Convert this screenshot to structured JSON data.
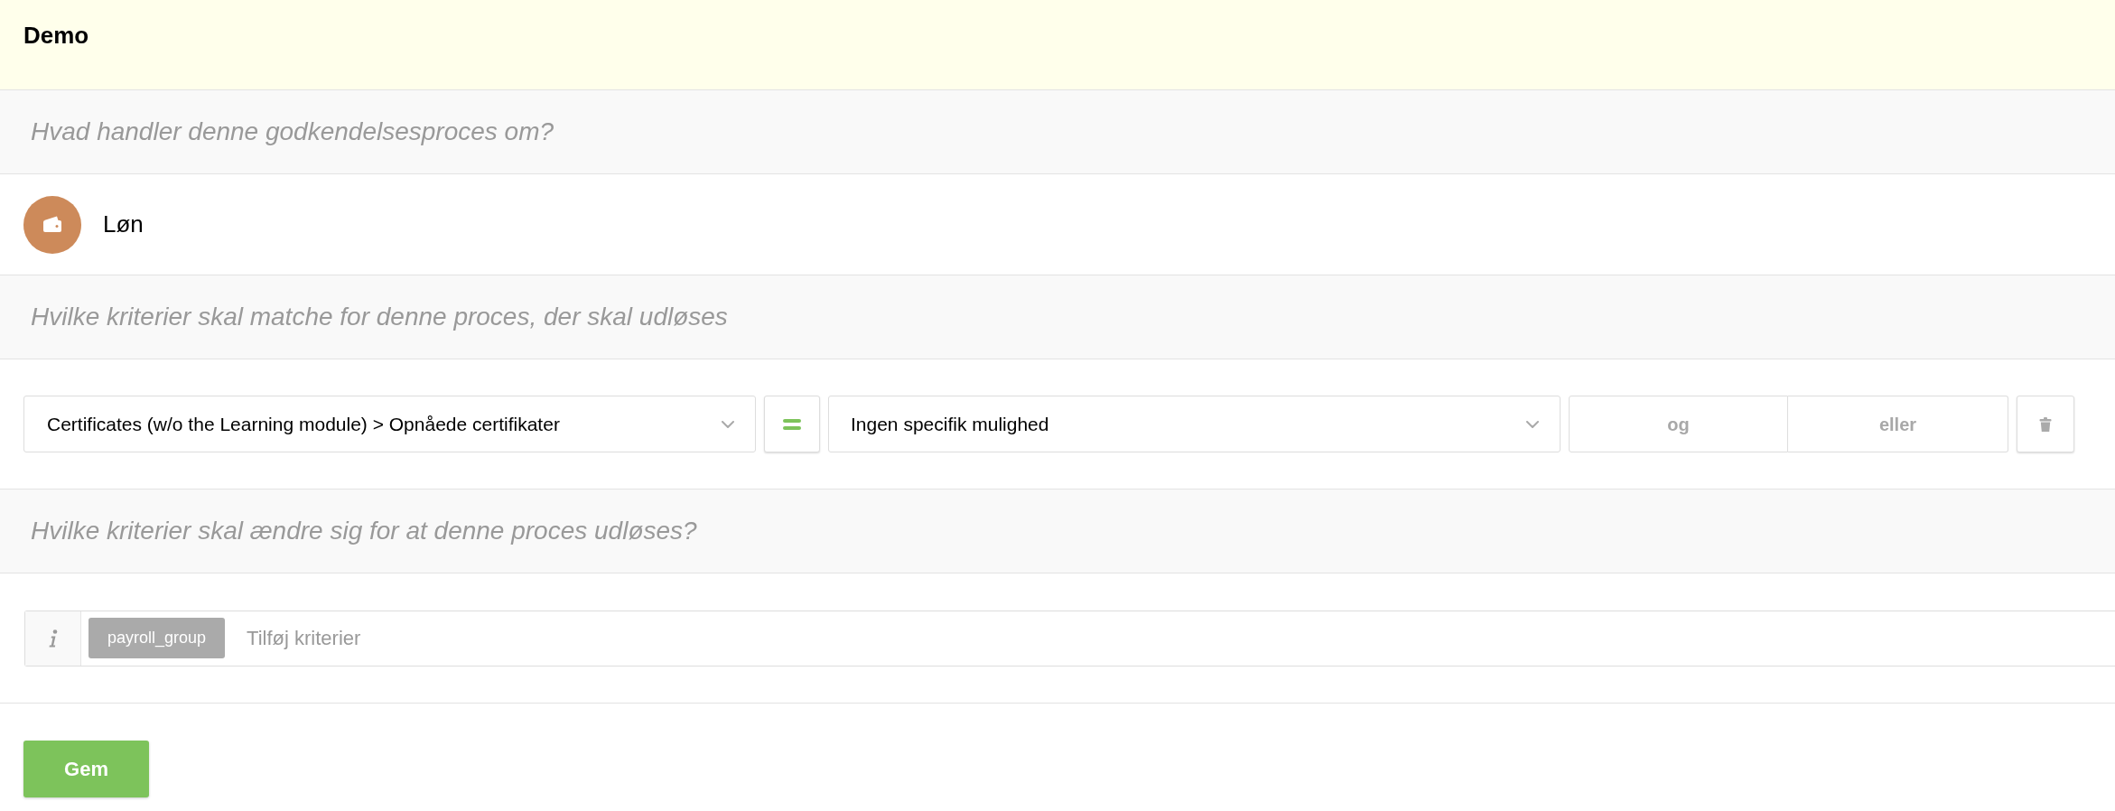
{
  "header": {
    "title": "Demo"
  },
  "sections": [
    {
      "kind": "category",
      "heading": "Hvad handler denne godkendelsesproces om?",
      "category": {
        "label": "Løn"
      }
    },
    {
      "kind": "conditions",
      "heading": "Hvilke kriterier skal matche for denne proces, der skal udløses",
      "conditions": [
        {
          "field": "Certificates (w/o the Learning module) > Opnåede certifikater",
          "value": "Ingen specifik mulighed",
          "connectors": [
            {
              "label": "og",
              "selected": false
            },
            {
              "label": "eller",
              "selected": false
            }
          ]
        }
      ]
    },
    {
      "kind": "tags",
      "heading": "Hvilke kriterier skal ændre sig for at denne proces udløses?",
      "tags": [
        "payroll_group"
      ],
      "placeholder": "Tilføj kriterier"
    }
  ],
  "save_button": "Gem"
}
